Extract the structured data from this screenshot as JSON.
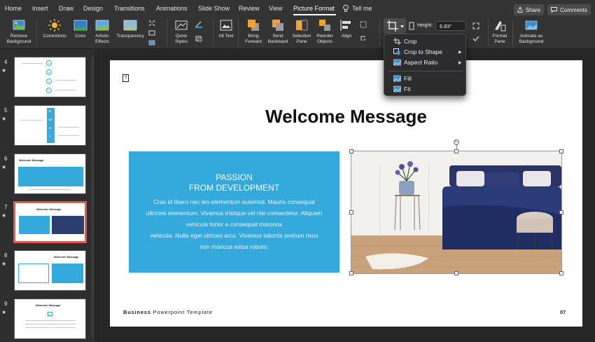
{
  "tabs": {
    "home": "Home",
    "insert": "Insert",
    "draw": "Draw",
    "design": "Design",
    "transitions": "Transitions",
    "animations": "Animations",
    "slide_show": "Slide Show",
    "review": "Review",
    "view": "View",
    "picture_format": "Picture Format",
    "tell_me": "Tell me",
    "active": "Picture Format"
  },
  "header_buttons": {
    "share": "Share",
    "comments": "Comments"
  },
  "ribbon": {
    "remove_background": "Remove Background",
    "corrections": "Corrections",
    "color": "Color",
    "artistic_effects": "Artistic Effects",
    "transparency": "Transparency",
    "quick_styles": "Quick Styles",
    "alt_text": "Alt Text",
    "bring_forward": "Bring Forward",
    "send_backward": "Send Backward",
    "selection_pane": "Selection Pane",
    "reorder_objects": "Reorder Objects",
    "align": "Align",
    "height_label": "Height:",
    "height_value": "6.83\"",
    "format_pane": "Format Pane",
    "animate_as_background": "Animate as Background"
  },
  "crop_menu": {
    "crop": "Crop",
    "crop_to_shape": "Crop to Shape",
    "aspect_ratio": "Aspect Ratio",
    "fill": "Fill",
    "fit": "Fit"
  },
  "thumbnails": [
    {
      "number": "4",
      "star": "★",
      "swot_letters": [
        "S",
        "W",
        "O",
        "T"
      ]
    },
    {
      "number": "5",
      "star": "★",
      "swot_letters": [
        "S",
        "W",
        "O",
        "T"
      ]
    },
    {
      "number": "6",
      "star": "★",
      "title": "Welcome Message"
    },
    {
      "number": "7",
      "star": "★",
      "title": "Welcome Message",
      "selected": true
    },
    {
      "number": "8",
      "star": "★",
      "title": "Welcome Message"
    },
    {
      "number": "9",
      "star": "★",
      "title": "Welcome Message"
    }
  ],
  "slide": {
    "icon_glyph": "?",
    "title": "Welcome Message",
    "heading_line1": "PASSION",
    "heading_line2": "FROM DEVELOPMENT",
    "body": [
      "Cras id libero nec leo elementum euismod. Mauris consequat",
      "ultricies elementum. Vivamus tristique vel nisi consectetur. Aliquam",
      "vehicula tortor a consequat moronos",
      "vehicula. Nulla eget ultrices arcu. Vivamus lobortis pretium risus",
      "non rhoncus estus roboto."
    ],
    "footer_bold": "Business",
    "footer_rest": " Powerpoint Template",
    "page_number": "07"
  },
  "colors": {
    "accent_blue": "#34a9dc",
    "ribbon_bg": "#333333",
    "selected_thumb_border": "#e05a4a"
  }
}
